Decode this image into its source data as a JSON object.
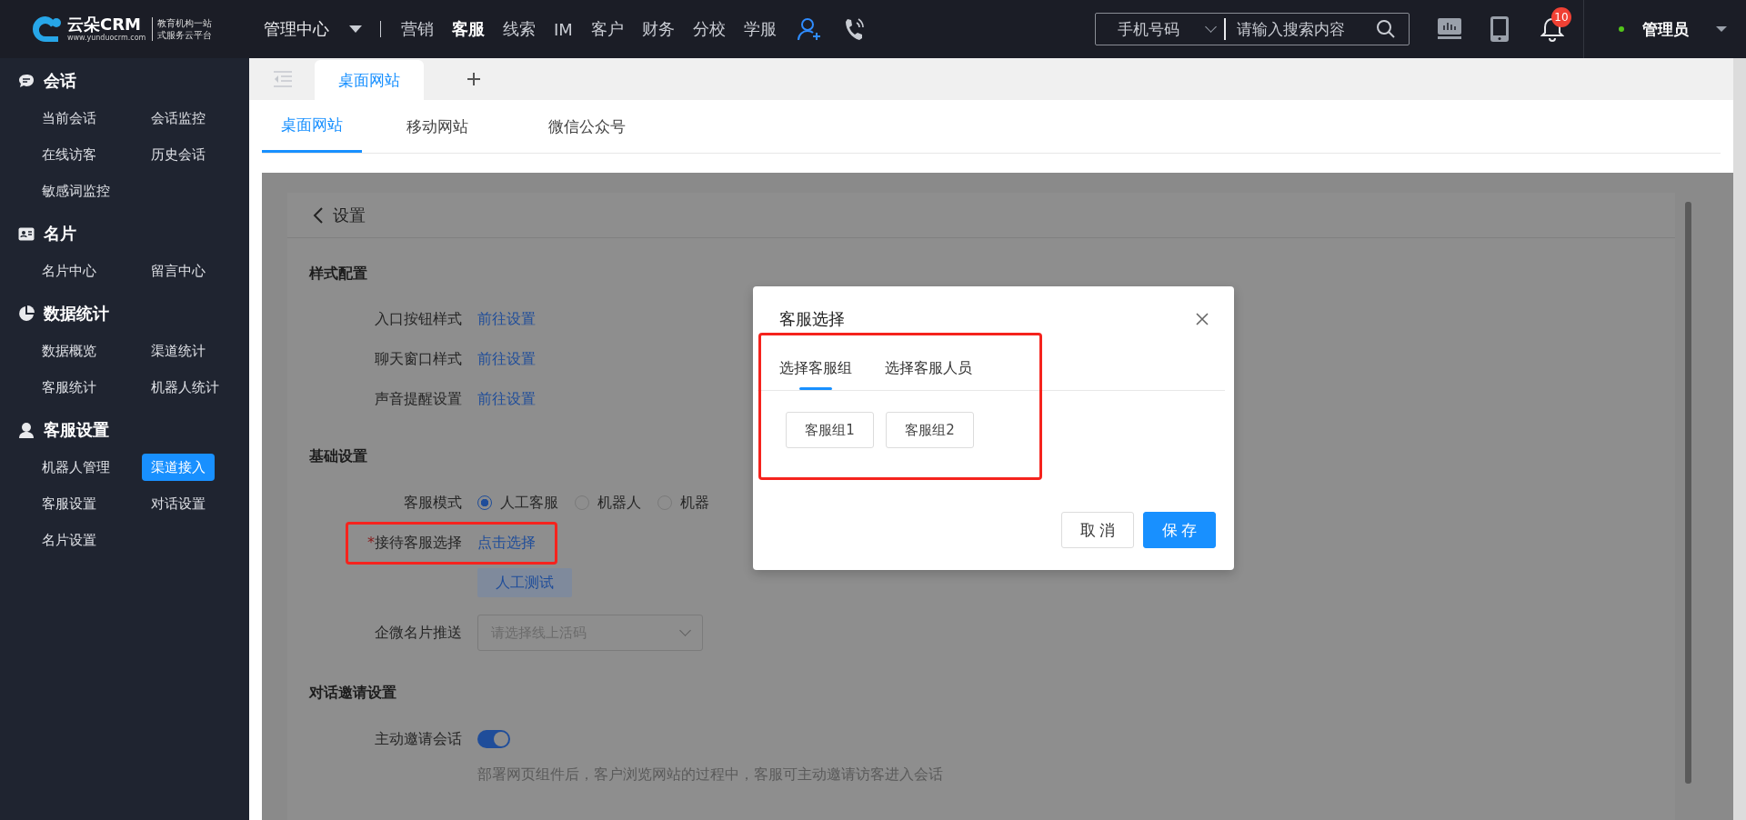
{
  "brand": {
    "name": "云朵CRM",
    "url": "www.yunduocrm.com",
    "slogan": [
      "教育机构一站",
      "式服务云平台"
    ]
  },
  "top_nav": {
    "module": "管理中心",
    "items": [
      {
        "label": "营销",
        "selected": false
      },
      {
        "label": "客服",
        "selected": true
      },
      {
        "label": "线索",
        "selected": false
      },
      {
        "label": "IM",
        "selected": false
      },
      {
        "label": "客户",
        "selected": false
      },
      {
        "label": "财务",
        "selected": false
      },
      {
        "label": "分校",
        "selected": false
      },
      {
        "label": "学服",
        "selected": false
      }
    ]
  },
  "search": {
    "type": "手机号码",
    "placeholder": "请输入搜索内容"
  },
  "notifications": {
    "count": "10"
  },
  "user": {
    "name": "管理员",
    "online": true
  },
  "sidebar": {
    "sections": [
      {
        "title": "会话",
        "items": [
          {
            "label": "当前会话",
            "selected": false
          },
          {
            "label": "会话监控",
            "selected": false
          },
          {
            "label": "在线访客",
            "selected": false
          },
          {
            "label": "历史会话",
            "selected": false
          },
          {
            "label": "敏感词监控",
            "selected": false
          }
        ]
      },
      {
        "title": "名片",
        "items": [
          {
            "label": "名片中心",
            "selected": false
          },
          {
            "label": "留言中心",
            "selected": false
          }
        ]
      },
      {
        "title": "数据统计",
        "items": [
          {
            "label": "数据概览",
            "selected": false
          },
          {
            "label": "渠道统计",
            "selected": false
          },
          {
            "label": "客服统计",
            "selected": false
          },
          {
            "label": "机器人统计",
            "selected": false
          }
        ]
      },
      {
        "title": "客服设置",
        "items": [
          {
            "label": "机器人管理",
            "selected": false
          },
          {
            "label": "渠道接入",
            "selected": true
          },
          {
            "label": "客服设置",
            "selected": false
          },
          {
            "label": "对话设置",
            "selected": false
          },
          {
            "label": "名片设置",
            "selected": false
          }
        ]
      }
    ]
  },
  "page_tabs": [
    {
      "label": "桌面网站",
      "selected": true
    }
  ],
  "sub_tabs": [
    {
      "label": "桌面网站",
      "selected": true
    },
    {
      "label": "移动网站",
      "selected": false
    },
    {
      "label": "微信公众号",
      "selected": false
    }
  ],
  "settings": {
    "back": "设置",
    "sections": [
      {
        "title": "样式配置",
        "rows": [
          {
            "kind": "link",
            "label": "入口按钮样式",
            "value": "前往设置"
          },
          {
            "kind": "link",
            "label": "聊天窗口样式",
            "value": "前往设置"
          },
          {
            "kind": "link",
            "label": "声音提醒设置",
            "value": "前往设置"
          }
        ]
      },
      {
        "title": "基础设置",
        "rows": [
          {
            "kind": "radio",
            "label": "客服模式",
            "options": [
              {
                "label": "人工客服",
                "selected": true
              },
              {
                "label": "机器人",
                "selected": false
              },
              {
                "label": "机器",
                "selected": false
              }
            ]
          },
          {
            "kind": "link",
            "label": "接待客服选择",
            "required": "*",
            "annotated": true,
            "value": "点击选择"
          },
          {
            "kind": "button",
            "value": "人工测试"
          },
          {
            "kind": "select",
            "label": "企微名片推送",
            "placeholder": "请选择线上活码"
          }
        ]
      },
      {
        "title": "对话邀请设置",
        "rows": [
          {
            "kind": "switch",
            "label": "主动邀请会话",
            "on": true
          },
          {
            "kind": "note",
            "value": "部署网页组件后，客户浏览网站的过程中，客服可主动邀请访客进入会话"
          }
        ]
      }
    ]
  },
  "modal": {
    "title": "客服选择",
    "annotated": true,
    "tabs": [
      {
        "label": "选择客服组",
        "selected": true
      },
      {
        "label": "选择客服人员",
        "selected": false
      }
    ],
    "options": [
      "客服组1",
      "客服组2"
    ],
    "buttons": [
      {
        "label": "取消",
        "kind": "default"
      },
      {
        "label": "保存",
        "kind": "primary"
      }
    ]
  }
}
